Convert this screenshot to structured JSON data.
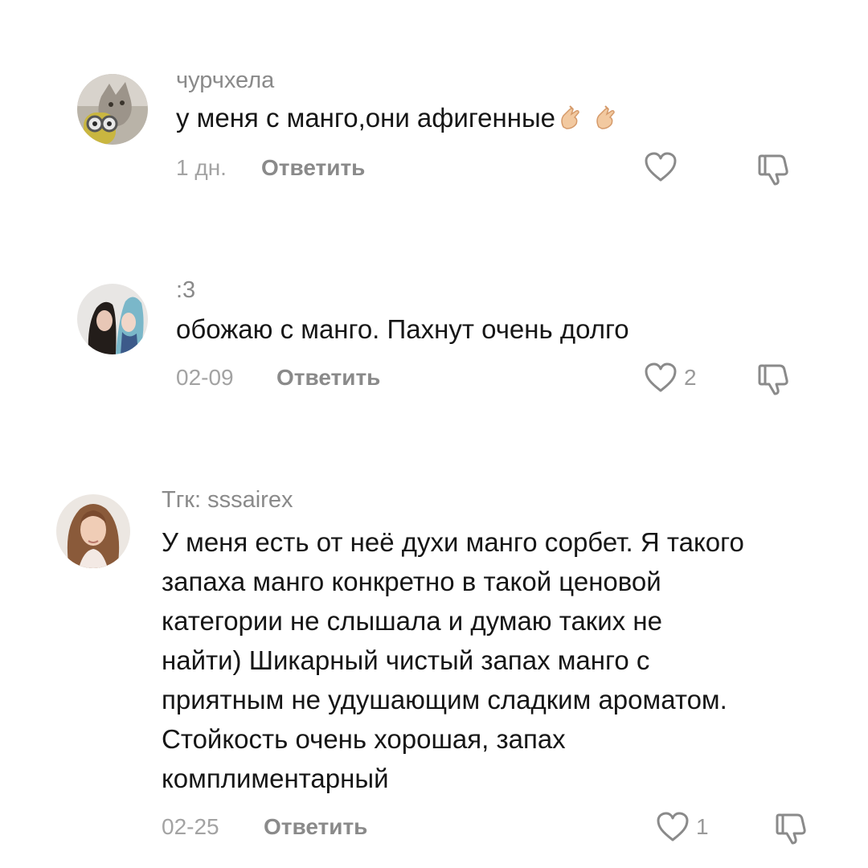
{
  "comments": [
    {
      "username": "чурчхела",
      "text": "у меня с манго,они афигенные",
      "emoji": "finger-heart-icon",
      "time": "1 дн.",
      "reply_label": "Ответить",
      "likes": ""
    },
    {
      "username": ":3",
      "text": "обожаю с манго. Пахнут очень долго",
      "time": "02-09",
      "reply_label": "Ответить",
      "likes": "2"
    },
    {
      "username": "Тгк: sssairex",
      "text_lines": [
        "У меня есть от неё духи манго сорбет. Я такого",
        "запаха манго конкретно в такой ценовой",
        "категории не слышала и думаю таких не",
        "найти) Шикарный чистый запах манго с",
        "приятным не удушающим сладким ароматом.",
        "Стойкость очень хорошая, запах",
        "комплиментарный"
      ],
      "time": "02-25",
      "reply_label": "Ответить",
      "likes": "1"
    }
  ],
  "colors": {
    "text": "#161616",
    "username": "#8a8a8a",
    "meta": "#a3a3a3",
    "icon": "#8a8a8a",
    "background": "#ffffff"
  }
}
